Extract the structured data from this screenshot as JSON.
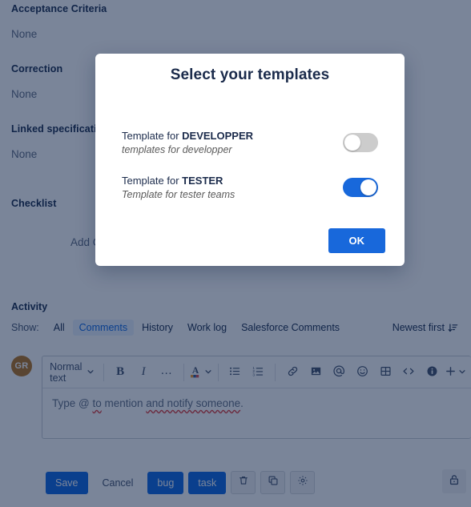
{
  "page": {
    "fields": [
      {
        "label": "Acceptance Criteria",
        "value": "None"
      },
      {
        "label": "Correction",
        "value": "None"
      },
      {
        "label": "Linked specification",
        "value": "None"
      }
    ],
    "checklist": {
      "label": "Checklist",
      "add_label": "Add C"
    },
    "activity": {
      "title": "Activity",
      "show_label": "Show:",
      "filters": [
        {
          "label": "All",
          "active": false
        },
        {
          "label": "Comments",
          "active": true
        },
        {
          "label": "History",
          "active": false
        },
        {
          "label": "Work log",
          "active": false
        },
        {
          "label": "Salesforce Comments",
          "active": false
        }
      ],
      "sort_label": "Newest first",
      "sort_icon": "sort-descending-icon"
    },
    "composer": {
      "avatar_initials": "GR",
      "toolbar": {
        "text_style": "Normal text",
        "bold": "B",
        "italic": "I",
        "more": "…",
        "text_color_icon": "text-color-icon",
        "bullet_list_icon": "bullet-list-icon",
        "numbered_list_icon": "numbered-list-icon",
        "link_icon": "link-icon",
        "image_icon": "image-icon",
        "mention_icon": "mention-icon",
        "emoji_icon": "emoji-icon",
        "table_icon": "table-icon",
        "code_icon": "code-icon",
        "info_icon": "info-panel-icon",
        "plus_icon": "plus-icon",
        "chevron_icon": "chevron-down-icon"
      },
      "placeholder_parts": {
        "p1": "Type @ ",
        "p2": "to",
        "p3": " mention ",
        "p4": "and notify someone",
        "p5": "."
      },
      "placeholder_full": "Type @ to mention and notify someone."
    },
    "actions": {
      "save": "Save",
      "cancel": "Cancel",
      "tag_bug": "bug",
      "tag_task": "task",
      "delete_icon": "trash-icon",
      "copy_icon": "copy-icon",
      "settings_icon": "gear-icon",
      "lock_icon": "unlocked-padlock-icon"
    }
  },
  "modal": {
    "title": "Select your templates",
    "templates": [
      {
        "prefix": "Template for ",
        "name": "DEVELOPPER",
        "description": "templates for developper",
        "enabled": false
      },
      {
        "prefix": "Template for ",
        "name": "TESTER",
        "description": "Template for tester teams",
        "enabled": true
      }
    ],
    "ok_label": "OK"
  },
  "colors": {
    "accent_blue": "#0c66e4",
    "modal_blue": "#1868db",
    "toggle_off": "#cccccc",
    "avatar": "#b8751f",
    "title_navy": "#1b2b4b",
    "overlay": "rgba(9,30,66,0.54)"
  }
}
